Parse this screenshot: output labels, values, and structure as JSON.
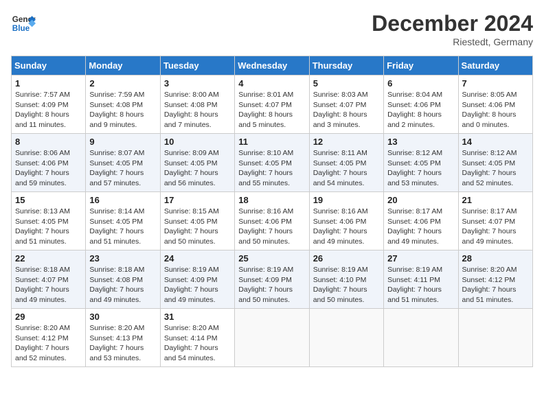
{
  "header": {
    "logo_line1": "General",
    "logo_line2": "Blue",
    "month_title": "December 2024",
    "location": "Riestedt, Germany"
  },
  "weekdays": [
    "Sunday",
    "Monday",
    "Tuesday",
    "Wednesday",
    "Thursday",
    "Friday",
    "Saturday"
  ],
  "weeks": [
    [
      {
        "day": "1",
        "sunrise": "7:57 AM",
        "sunset": "4:09 PM",
        "daylight": "8 hours and 11 minutes."
      },
      {
        "day": "2",
        "sunrise": "7:59 AM",
        "sunset": "4:08 PM",
        "daylight": "8 hours and 9 minutes."
      },
      {
        "day": "3",
        "sunrise": "8:00 AM",
        "sunset": "4:08 PM",
        "daylight": "8 hours and 7 minutes."
      },
      {
        "day": "4",
        "sunrise": "8:01 AM",
        "sunset": "4:07 PM",
        "daylight": "8 hours and 5 minutes."
      },
      {
        "day": "5",
        "sunrise": "8:03 AM",
        "sunset": "4:07 PM",
        "daylight": "8 hours and 3 minutes."
      },
      {
        "day": "6",
        "sunrise": "8:04 AM",
        "sunset": "4:06 PM",
        "daylight": "8 hours and 2 minutes."
      },
      {
        "day": "7",
        "sunrise": "8:05 AM",
        "sunset": "4:06 PM",
        "daylight": "8 hours and 0 minutes."
      }
    ],
    [
      {
        "day": "8",
        "sunrise": "8:06 AM",
        "sunset": "4:06 PM",
        "daylight": "7 hours and 59 minutes."
      },
      {
        "day": "9",
        "sunrise": "8:07 AM",
        "sunset": "4:05 PM",
        "daylight": "7 hours and 57 minutes."
      },
      {
        "day": "10",
        "sunrise": "8:09 AM",
        "sunset": "4:05 PM",
        "daylight": "7 hours and 56 minutes."
      },
      {
        "day": "11",
        "sunrise": "8:10 AM",
        "sunset": "4:05 PM",
        "daylight": "7 hours and 55 minutes."
      },
      {
        "day": "12",
        "sunrise": "8:11 AM",
        "sunset": "4:05 PM",
        "daylight": "7 hours and 54 minutes."
      },
      {
        "day": "13",
        "sunrise": "8:12 AM",
        "sunset": "4:05 PM",
        "daylight": "7 hours and 53 minutes."
      },
      {
        "day": "14",
        "sunrise": "8:12 AM",
        "sunset": "4:05 PM",
        "daylight": "7 hours and 52 minutes."
      }
    ],
    [
      {
        "day": "15",
        "sunrise": "8:13 AM",
        "sunset": "4:05 PM",
        "daylight": "7 hours and 51 minutes."
      },
      {
        "day": "16",
        "sunrise": "8:14 AM",
        "sunset": "4:05 PM",
        "daylight": "7 hours and 51 minutes."
      },
      {
        "day": "17",
        "sunrise": "8:15 AM",
        "sunset": "4:05 PM",
        "daylight": "7 hours and 50 minutes."
      },
      {
        "day": "18",
        "sunrise": "8:16 AM",
        "sunset": "4:06 PM",
        "daylight": "7 hours and 50 minutes."
      },
      {
        "day": "19",
        "sunrise": "8:16 AM",
        "sunset": "4:06 PM",
        "daylight": "7 hours and 49 minutes."
      },
      {
        "day": "20",
        "sunrise": "8:17 AM",
        "sunset": "4:06 PM",
        "daylight": "7 hours and 49 minutes."
      },
      {
        "day": "21",
        "sunrise": "8:17 AM",
        "sunset": "4:07 PM",
        "daylight": "7 hours and 49 minutes."
      }
    ],
    [
      {
        "day": "22",
        "sunrise": "8:18 AM",
        "sunset": "4:07 PM",
        "daylight": "7 hours and 49 minutes."
      },
      {
        "day": "23",
        "sunrise": "8:18 AM",
        "sunset": "4:08 PM",
        "daylight": "7 hours and 49 minutes."
      },
      {
        "day": "24",
        "sunrise": "8:19 AM",
        "sunset": "4:09 PM",
        "daylight": "7 hours and 49 minutes."
      },
      {
        "day": "25",
        "sunrise": "8:19 AM",
        "sunset": "4:09 PM",
        "daylight": "7 hours and 50 minutes."
      },
      {
        "day": "26",
        "sunrise": "8:19 AM",
        "sunset": "4:10 PM",
        "daylight": "7 hours and 50 minutes."
      },
      {
        "day": "27",
        "sunrise": "8:19 AM",
        "sunset": "4:11 PM",
        "daylight": "7 hours and 51 minutes."
      },
      {
        "day": "28",
        "sunrise": "8:20 AM",
        "sunset": "4:12 PM",
        "daylight": "7 hours and 51 minutes."
      }
    ],
    [
      {
        "day": "29",
        "sunrise": "8:20 AM",
        "sunset": "4:12 PM",
        "daylight": "7 hours and 52 minutes."
      },
      {
        "day": "30",
        "sunrise": "8:20 AM",
        "sunset": "4:13 PM",
        "daylight": "7 hours and 53 minutes."
      },
      {
        "day": "31",
        "sunrise": "8:20 AM",
        "sunset": "4:14 PM",
        "daylight": "7 hours and 54 minutes."
      },
      null,
      null,
      null,
      null
    ]
  ]
}
